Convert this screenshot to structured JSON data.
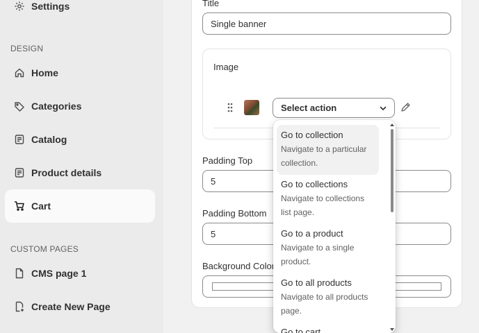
{
  "sidebar": {
    "settings_label": "Settings",
    "design_section": "DESIGN",
    "items": [
      {
        "label": "Home",
        "icon": "home-icon"
      },
      {
        "label": "Categories",
        "icon": "tag-icon"
      },
      {
        "label": "Catalog",
        "icon": "catalog-icon"
      },
      {
        "label": "Product details",
        "icon": "product-details-icon"
      },
      {
        "label": "Cart",
        "icon": "cart-icon",
        "active": true
      }
    ],
    "custom_section": "CUSTOM PAGES",
    "custom_items": [
      {
        "label": "CMS page 1",
        "icon": "page-icon"
      },
      {
        "label": "Create New Page",
        "icon": "new-page-icon"
      }
    ]
  },
  "form": {
    "title_label": "Title",
    "title_value": "Single banner",
    "image_label": "Image",
    "select_action_label": "Select action",
    "padding_top_label": "Padding Top",
    "padding_top_value": "5",
    "padding_bottom_label": "Padding Bottom",
    "padding_bottom_value": "5",
    "background_color_label": "Background Color"
  },
  "dropdown": {
    "items": [
      {
        "title": "Go to collection",
        "desc": "Navigate to a particular collection."
      },
      {
        "title": "Go to collections",
        "desc": "Navigate to collections list page."
      },
      {
        "title": "Go to a product",
        "desc": "Navigate to a single product."
      },
      {
        "title": "Go to all products",
        "desc": "Navigate to all products page."
      },
      {
        "title": "Go to cart",
        "desc": ""
      }
    ]
  },
  "colors": {
    "sidebar_bg": "#ebebeb",
    "active_item_bg": "#fafafa",
    "page_bg": "#f1f1f1",
    "border": "#8a8a8a"
  }
}
